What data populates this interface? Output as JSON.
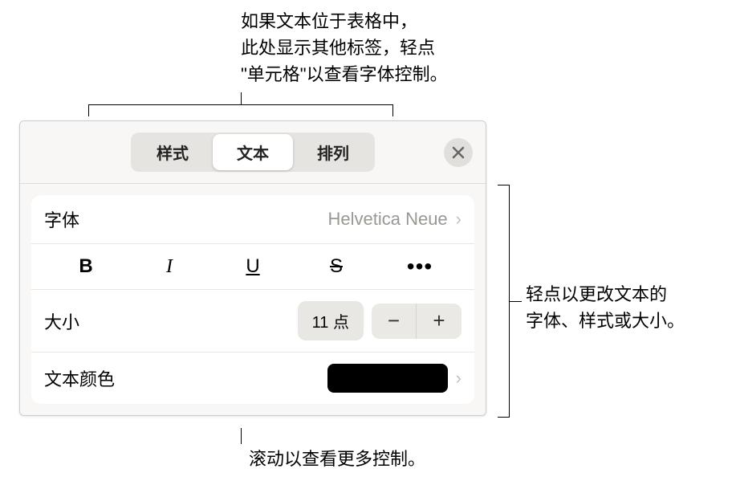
{
  "annotations": {
    "top": "如果文本位于表格中，\n此处显示其他标签，轻点\n\"单元格\"以查看字体控制。",
    "right": "轻点以更改文本的\n字体、样式或大小。",
    "bottom": "滚动以查看更多控制。"
  },
  "header": {
    "tabs": {
      "style": "样式",
      "text": "文本",
      "arrange": "排列"
    }
  },
  "body": {
    "font": {
      "label": "字体",
      "value": "Helvetica Neue"
    },
    "styles": {
      "bold": "B",
      "italic": "I",
      "underline": "U",
      "strike": "S",
      "more": "•••"
    },
    "size": {
      "label": "大小",
      "value": "11 点",
      "minus": "−",
      "plus": "+"
    },
    "color": {
      "label": "文本颜色",
      "value": "#000000"
    }
  }
}
